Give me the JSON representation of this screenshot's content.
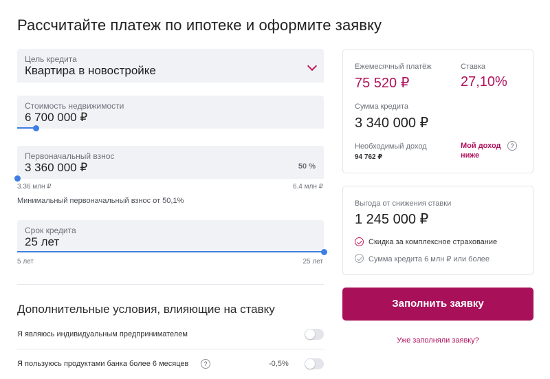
{
  "title": "Рассчитайте платеж по ипотеке и оформите заявку",
  "purpose": {
    "label": "Цель кредита",
    "value": "Квартира в новостройке"
  },
  "price": {
    "label": "Стоимость недвижимости",
    "value": "6 700 000 ₽",
    "slider_fraction": 0.06
  },
  "down_payment": {
    "label": "Первоначальный взнос",
    "value": "3 360 000 ₽",
    "percent": "50 %",
    "min_tick": "3.36 млн ₽",
    "max_tick": "6.4 млн ₽",
    "note": "Минимальный первоначальный взнос от 50,1%",
    "slider_fraction": 0.0
  },
  "term": {
    "label": "Срок кредита",
    "value": "25 лет",
    "min_tick": "5 лет",
    "max_tick": "25 лет",
    "slider_fraction": 1.0
  },
  "conditions": {
    "title": "Дополнительные условия, влияющие на ставку",
    "items": [
      {
        "label": "Я являюсь индивидуальным предпринимателем",
        "value": "",
        "enabled": false
      },
      {
        "label": "Я пользуюсь продуктами банка более 6 месяцев",
        "value": "-0,5%",
        "enabled": false
      }
    ]
  },
  "summary": {
    "monthly_label": "Ежемесячный платёж",
    "monthly_value": "75 520 ₽",
    "rate_label": "Ставка",
    "rate_value": "27,10%",
    "loan_label": "Сумма кредита",
    "loan_value": "3 340 000 ₽",
    "income_label": "Необходимый доход",
    "income_value": "94 762 ₽",
    "income_link_line1": "Мой доход",
    "income_link_line2": "ниже"
  },
  "benefit": {
    "label": "Выгода от снижения ставки",
    "value": "1 245 000 ₽",
    "items": [
      {
        "label": "Скидка за комплексное страхование",
        "active": true
      },
      {
        "label": "Сумма кредита 6 млн ₽ или более",
        "active": false
      }
    ]
  },
  "submit_label": "Заполнить заявку",
  "already_link": "Уже заполняли заявку?",
  "colors": {
    "accent": "#a8105a",
    "pink_text": "#b0125d",
    "slider": "#3d7ee3",
    "field_bg": "#f1f2f6"
  },
  "icons": {
    "dropdown": "chevron-down-icon",
    "help": "question-circle-icon",
    "check": "check-circle-icon"
  }
}
